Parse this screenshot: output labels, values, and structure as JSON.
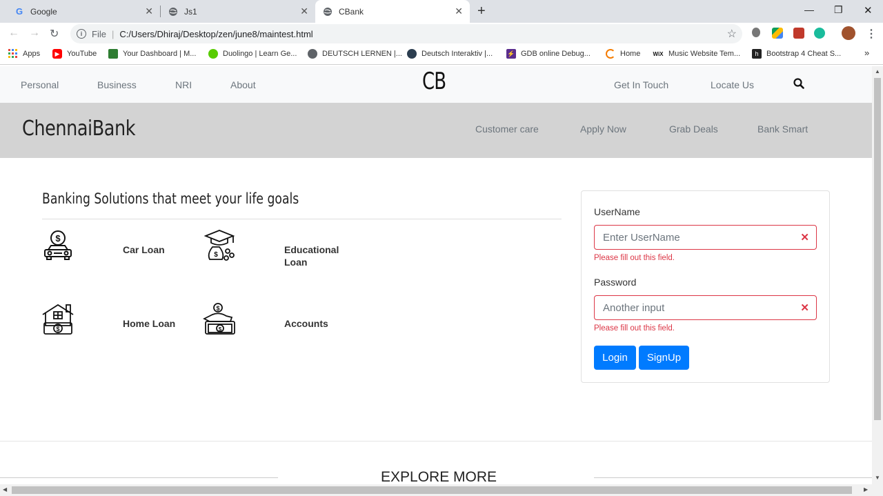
{
  "browser": {
    "tabs": [
      {
        "title": "Google",
        "icon": "google-icon"
      },
      {
        "title": "Js1",
        "icon": "globe-icon"
      },
      {
        "title": "CBank",
        "icon": "globe-icon"
      }
    ],
    "url_scheme": "File",
    "url": "C:/Users/Dhiraj/Desktop/zen/june8/maintest.html",
    "bookmarks": [
      {
        "label": "Apps"
      },
      {
        "label": "YouTube"
      },
      {
        "label": "Your Dashboard | M..."
      },
      {
        "label": "Duolingo | Learn Ge..."
      },
      {
        "label": "DEUTSCH LERNEN |..."
      },
      {
        "label": "Deutsch Interaktiv |..."
      },
      {
        "label": "GDB online Debug..."
      },
      {
        "label": "Home"
      },
      {
        "label": "Music Website Tem..."
      },
      {
        "label": "Bootstrap 4 Cheat S..."
      }
    ],
    "more_bookmarks": "»"
  },
  "topnav": {
    "links": [
      "Personal",
      "Business",
      "NRI",
      "About"
    ],
    "brand": "CB",
    "right_links": [
      "Get In Touch",
      "Locate Us"
    ]
  },
  "subnav": {
    "title": "ChennaiBank",
    "links": [
      "Customer care",
      "Apply Now",
      "Grab Deals",
      "Bank Smart"
    ]
  },
  "solutions": {
    "heading": "Banking Solutions that meet your life goals",
    "items": [
      {
        "label": "Car Loan",
        "icon": "car-loan-icon"
      },
      {
        "label": "Educational Loan",
        "icon": "education-loan-icon"
      },
      {
        "label": "Home Loan",
        "icon": "home-loan-icon"
      },
      {
        "label": "Accounts",
        "icon": "accounts-icon"
      }
    ]
  },
  "login": {
    "username_label": "UserName",
    "username_placeholder": "Enter UserName",
    "username_error": "Please fill out this field.",
    "password_label": "Password",
    "password_placeholder": "Another input",
    "password_error": "Please fill out this field.",
    "login_button": "Login",
    "signup_button": "SignUp"
  },
  "explore": {
    "title": "EXPLORE MORE"
  },
  "colors": {
    "primary": "#007bff",
    "danger": "#dc3545",
    "subnav_bg": "#d3d3d3",
    "topnav_bg": "#f8f9fa"
  }
}
